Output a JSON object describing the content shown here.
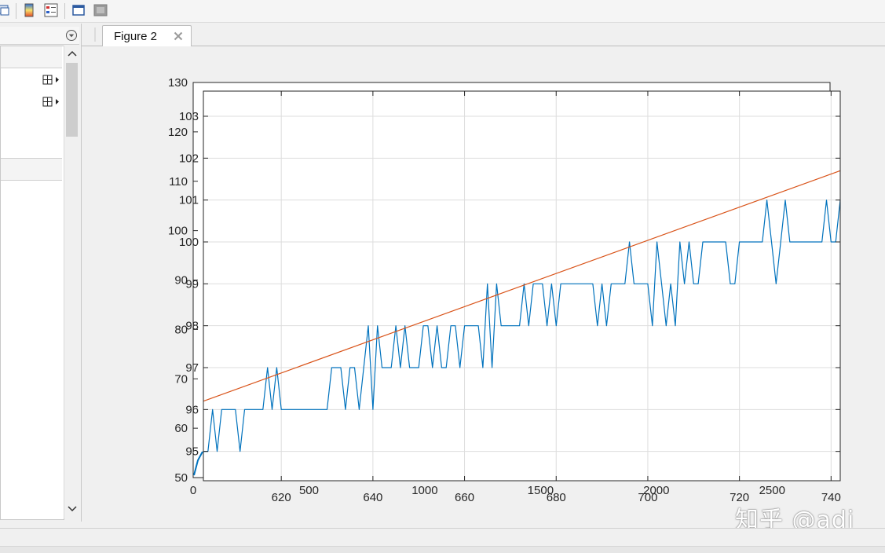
{
  "toolbar": {
    "icons": [
      "view-switch-icon",
      "colorbar-icon",
      "legend-icon",
      "dock-window-icon",
      "undock-window-icon"
    ]
  },
  "left_panel": {
    "items": [
      {
        "icon": "grid-expand-icon"
      },
      {
        "icon": "grid-expand-icon"
      }
    ]
  },
  "tabs": [
    {
      "label": "Figure 2"
    }
  ],
  "watermark": "知乎 @adi",
  "colors": {
    "series_blue": "#0072bd",
    "series_orange": "#d95319",
    "plot_bg": "#ffffff",
    "grid": "#dddddd",
    "figure_bg": "#f0f0f0"
  },
  "chart_data": [
    {
      "type": "line",
      "title": "",
      "xlabel": "",
      "ylabel": "",
      "grid": false,
      "xlim": [
        0,
        2750
      ],
      "ylim": [
        50,
        130
      ],
      "xticks": [
        "0",
        "500",
        "1000",
        "1500",
        "2000",
        "2500"
      ],
      "yticks": [
        "50",
        "60",
        "70",
        "80",
        "90",
        "100",
        "110",
        "120",
        "130"
      ],
      "series": []
    },
    {
      "type": "line",
      "title": "",
      "xlabel": "",
      "ylabel": "",
      "grid": true,
      "xlim": [
        603,
        742
      ],
      "ylim": [
        94.3,
        103.6
      ],
      "xticks": [
        "620",
        "640",
        "660",
        "680",
        "700",
        "720",
        "740"
      ],
      "yticks": [
        "95",
        "96",
        "97",
        "98",
        "99",
        "100",
        "101",
        "102",
        "103"
      ],
      "series": [
        {
          "type": "step-line",
          "color": "#0072bd",
          "x": [
            603,
            604,
            605,
            606,
            607,
            608,
            609,
            610,
            611,
            612,
            613,
            614,
            615,
            616,
            617,
            618,
            619,
            620,
            621,
            622,
            623,
            624,
            625,
            626,
            627,
            628,
            629,
            630,
            631,
            632,
            633,
            634,
            635,
            636,
            637,
            638,
            639,
            640,
            641,
            642,
            643,
            644,
            645,
            646,
            647,
            648,
            649,
            650,
            651,
            652,
            653,
            654,
            655,
            656,
            657,
            658,
            659,
            660,
            661,
            662,
            663,
            664,
            665,
            666,
            667,
            668,
            669,
            670,
            671,
            672,
            673,
            674,
            675,
            676,
            677,
            678,
            679,
            680,
            681,
            682,
            683,
            684,
            685,
            686,
            687,
            688,
            689,
            690,
            691,
            692,
            693,
            694,
            695,
            696,
            697,
            698,
            699,
            700,
            701,
            702,
            703,
            704,
            705,
            706,
            707,
            708,
            709,
            710,
            711,
            712,
            713,
            714,
            715,
            716,
            717,
            718,
            719,
            720,
            721,
            722,
            723,
            724,
            725,
            726,
            727,
            728,
            729,
            730,
            731,
            732,
            733,
            734,
            735,
            736,
            737,
            738,
            739,
            740,
            741,
            742
          ],
          "y": [
            95,
            95,
            96,
            95,
            96,
            96,
            96,
            96,
            95,
            96,
            96,
            96,
            96,
            96,
            97,
            96,
            97,
            96,
            96,
            96,
            96,
            96,
            96,
            96,
            96,
            96,
            96,
            96,
            97,
            97,
            97,
            96,
            97,
            97,
            96,
            97,
            98,
            96,
            98,
            97,
            97,
            97,
            98,
            97,
            98,
            97,
            97,
            97,
            98,
            98,
            97,
            98,
            97,
            97,
            98,
            98,
            97,
            98,
            98,
            98,
            98,
            97,
            99,
            97,
            99,
            98,
            98,
            98,
            98,
            98,
            99,
            98,
            99,
            99,
            99,
            98,
            99,
            98,
            99,
            99,
            99,
            99,
            99,
            99,
            99,
            99,
            98,
            99,
            98,
            99,
            99,
            99,
            99,
            100,
            99,
            99,
            99,
            99,
            98,
            100,
            99,
            98,
            99,
            98,
            100,
            99,
            100,
            99,
            99,
            100,
            100,
            100,
            100,
            100,
            100,
            99,
            99,
            100,
            100,
            100,
            100,
            100,
            100,
            101,
            100,
            99,
            100,
            101,
            100,
            100,
            100,
            100,
            100,
            100,
            100,
            100,
            101,
            100,
            100,
            101
          ]
        },
        {
          "type": "line",
          "color": "#d95319",
          "x": [
            603,
            742
          ],
          "y": [
            96.2,
            101.7
          ]
        }
      ]
    }
  ]
}
